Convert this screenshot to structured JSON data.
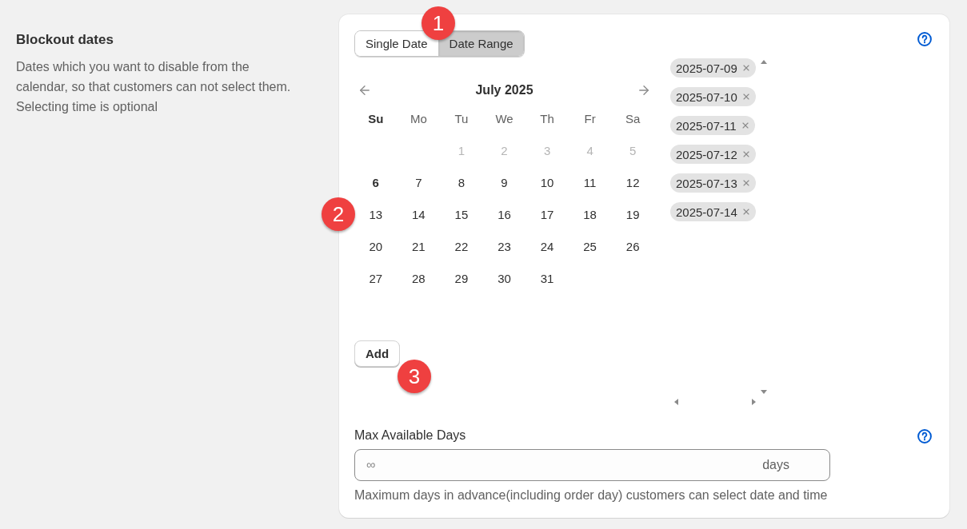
{
  "section": {
    "title": "Blockout dates",
    "description": "Dates which you want to disable from the calendar, so that customers can not select them. Selecting time is optional"
  },
  "mode_toggle": {
    "marker": "1",
    "options": [
      {
        "label": "Single Date",
        "selected": false
      },
      {
        "label": "Date Range",
        "selected": true
      }
    ]
  },
  "calendar": {
    "marker": "2",
    "month_title": "July 2025",
    "weekdays": [
      {
        "label": "Su",
        "today": true
      },
      {
        "label": "Mo",
        "today": false
      },
      {
        "label": "Tu",
        "today": false
      },
      {
        "label": "We",
        "today": false
      },
      {
        "label": "Th",
        "today": false
      },
      {
        "label": "Fr",
        "today": false
      },
      {
        "label": "Sa",
        "today": false
      }
    ],
    "days": [
      {
        "kind": "blank"
      },
      {
        "kind": "blank"
      },
      {
        "kind": "day",
        "label": "1",
        "disabled": true,
        "today": false
      },
      {
        "kind": "day",
        "label": "2",
        "disabled": true,
        "today": false
      },
      {
        "kind": "day",
        "label": "3",
        "disabled": true,
        "today": false
      },
      {
        "kind": "day",
        "label": "4",
        "disabled": true,
        "today": false
      },
      {
        "kind": "day",
        "label": "5",
        "disabled": true,
        "today": false
      },
      {
        "kind": "day",
        "label": "6",
        "disabled": false,
        "today": true
      },
      {
        "kind": "day",
        "label": "7",
        "disabled": false,
        "today": false
      },
      {
        "kind": "day",
        "label": "8",
        "disabled": false,
        "today": false
      },
      {
        "kind": "day",
        "label": "9",
        "disabled": false,
        "today": false
      },
      {
        "kind": "day",
        "label": "10",
        "disabled": false,
        "today": false
      },
      {
        "kind": "day",
        "label": "11",
        "disabled": false,
        "today": false
      },
      {
        "kind": "day",
        "label": "12",
        "disabled": false,
        "today": false
      },
      {
        "kind": "day",
        "label": "13",
        "disabled": false,
        "today": false
      },
      {
        "kind": "day",
        "label": "14",
        "disabled": false,
        "today": false
      },
      {
        "kind": "day",
        "label": "15",
        "disabled": false,
        "today": false
      },
      {
        "kind": "day",
        "label": "16",
        "disabled": false,
        "today": false
      },
      {
        "kind": "day",
        "label": "17",
        "disabled": false,
        "today": false
      },
      {
        "kind": "day",
        "label": "18",
        "disabled": false,
        "today": false
      },
      {
        "kind": "day",
        "label": "19",
        "disabled": false,
        "today": false
      },
      {
        "kind": "day",
        "label": "20",
        "disabled": false,
        "today": false
      },
      {
        "kind": "day",
        "label": "21",
        "disabled": false,
        "today": false
      },
      {
        "kind": "day",
        "label": "22",
        "disabled": false,
        "today": false
      },
      {
        "kind": "day",
        "label": "23",
        "disabled": false,
        "today": false
      },
      {
        "kind": "day",
        "label": "24",
        "disabled": false,
        "today": false
      },
      {
        "kind": "day",
        "label": "25",
        "disabled": false,
        "today": false
      },
      {
        "kind": "day",
        "label": "26",
        "disabled": false,
        "today": false
      },
      {
        "kind": "day",
        "label": "27",
        "disabled": false,
        "today": false
      },
      {
        "kind": "day",
        "label": "28",
        "disabled": false,
        "today": false
      },
      {
        "kind": "day",
        "label": "29",
        "disabled": false,
        "today": false
      },
      {
        "kind": "day",
        "label": "30",
        "disabled": false,
        "today": false
      },
      {
        "kind": "day",
        "label": "31",
        "disabled": false,
        "today": false
      }
    ]
  },
  "add_button": {
    "label": "Add",
    "marker": "3"
  },
  "blocked_dates": [
    {
      "label": "2025-07-09"
    },
    {
      "label": "2025-07-10"
    },
    {
      "label": "2025-07-11"
    },
    {
      "label": "2025-07-12"
    },
    {
      "label": "2025-07-13"
    },
    {
      "label": "2025-07-14"
    }
  ],
  "max_days": {
    "label": "Max Available Days",
    "placeholder": "∞",
    "suffix": "days",
    "help_text": "Maximum days in advance(including order day) customers can select date and time"
  }
}
